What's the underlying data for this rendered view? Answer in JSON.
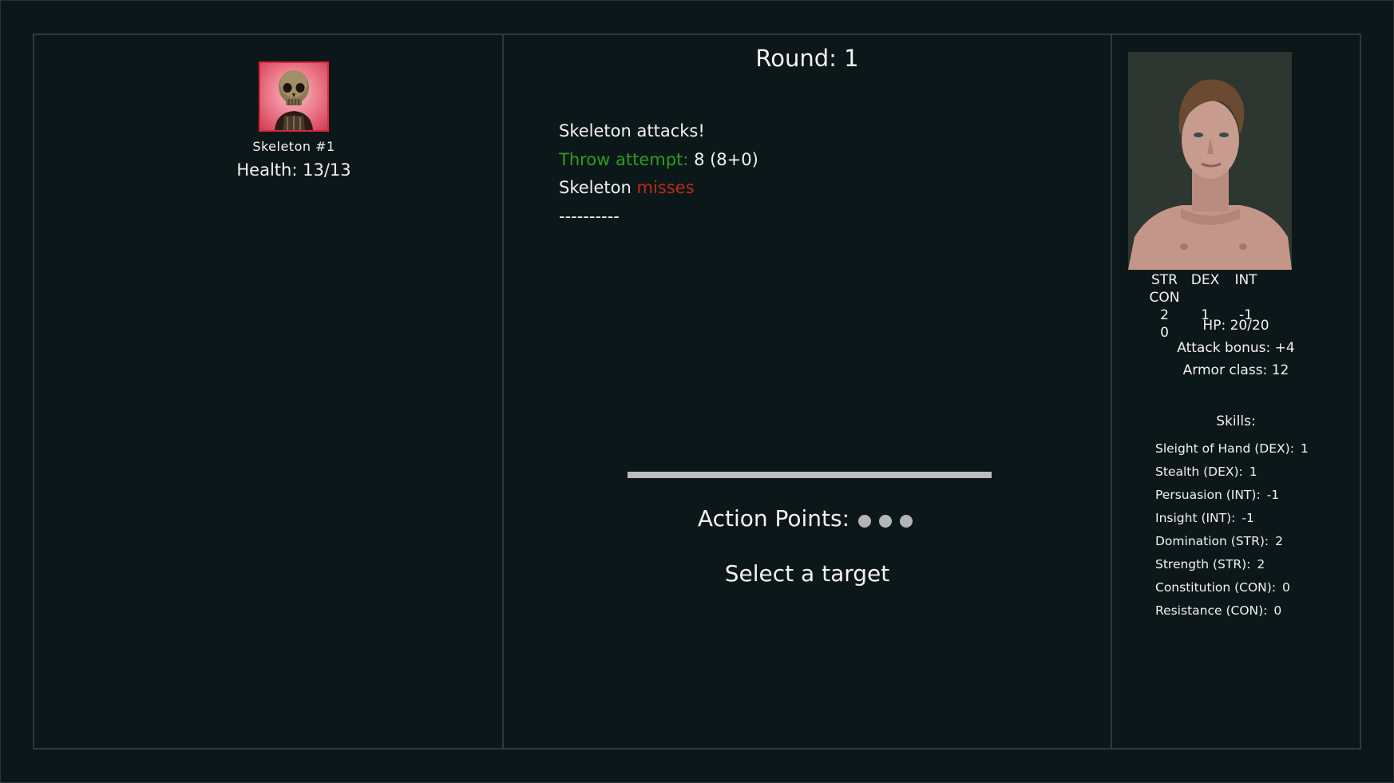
{
  "enemy": {
    "name": "Skeleton #1",
    "health_label": "Health:",
    "health_value": "13/13",
    "portrait_icon": "skeleton-portrait",
    "portrait_border_color": "#d8263c"
  },
  "combat": {
    "round_label": "Round:",
    "round_value": "1",
    "log": {
      "line1": "Skeleton attacks!",
      "line2_label": "Throw attempt:",
      "line2_value": "8 (8+0)",
      "line3_subject": "Skeleton",
      "line3_result": "misses",
      "line4": "----------"
    },
    "progress_fraction": 1.0,
    "action_points_label": "Action Points:",
    "action_points_count": 3,
    "prompt": "Select a target"
  },
  "hero": {
    "portrait_icon": "hero-portrait",
    "stats": [
      {
        "name": "STR",
        "value": "2"
      },
      {
        "name": "DEX",
        "value": "1"
      },
      {
        "name": "INT",
        "value": "-1"
      },
      {
        "name": "CON",
        "value": "0"
      }
    ],
    "hp_label": "HP:",
    "hp_value": "20/20",
    "attack_label": "Attack bonus:",
    "attack_value": "+4",
    "armor_label": "Armor class:",
    "armor_value": "12",
    "skills_title": "Skills:",
    "skills": [
      {
        "name": "Sleight of Hand (DEX):",
        "value": "1"
      },
      {
        "name": "Stealth (DEX):",
        "value": "1"
      },
      {
        "name": "Persuasion (INT):",
        "value": "-1"
      },
      {
        "name": "Insight (INT):",
        "value": "-1"
      },
      {
        "name": "Domination (STR):",
        "value": "2"
      },
      {
        "name": "Strength (STR):",
        "value": "2"
      },
      {
        "name": "Constitution (CON):",
        "value": "0"
      },
      {
        "name": "Resistance (CON):",
        "value": "0"
      }
    ]
  },
  "colors": {
    "background": "#0c1719",
    "hit_green": "#2c9d22",
    "miss_red": "#bb2a1c"
  }
}
